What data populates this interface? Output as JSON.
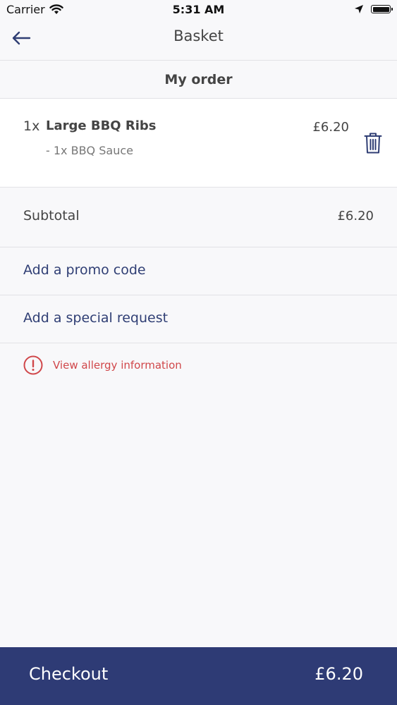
{
  "status_bar": {
    "carrier": "Carrier",
    "time": "5:31 AM"
  },
  "nav": {
    "title": "Basket"
  },
  "section": {
    "title": "My order"
  },
  "order": {
    "items": [
      {
        "quantity": "1x",
        "name": "Large BBQ Ribs",
        "modifier": "- 1x BBQ Sauce",
        "price": "£6.20"
      }
    ]
  },
  "summary": {
    "subtotal_label": "Subtotal",
    "subtotal_value": "£6.20",
    "promo_label": "Add a promo code",
    "special_request_label": "Add a special request",
    "allergy_label": "View allergy information"
  },
  "checkout": {
    "label": "Checkout",
    "total": "£6.20"
  },
  "colors": {
    "brand": "#2e3b75",
    "link": "#2f3e74",
    "alert": "#d0474a"
  },
  "icons": {
    "back": "arrow-left-icon",
    "delete": "trash-icon",
    "allergy": "alert-circle-icon"
  }
}
